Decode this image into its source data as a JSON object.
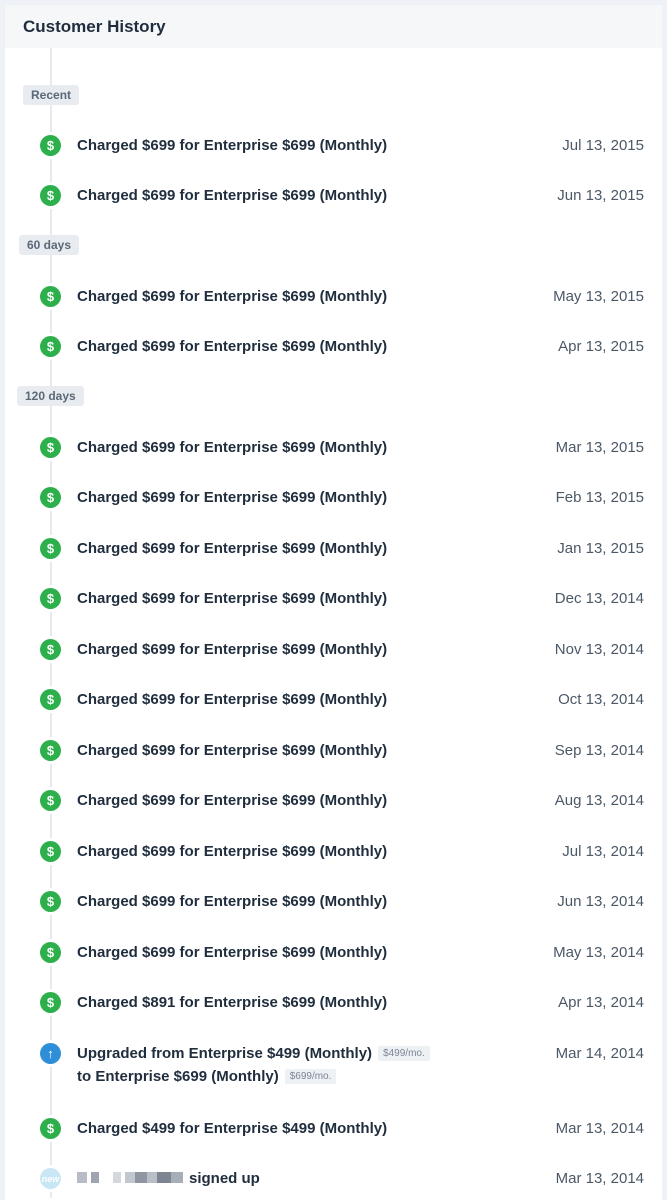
{
  "panel": {
    "title": "Customer History"
  },
  "groups": [
    {
      "label": "Recent"
    },
    {
      "label": "60 days"
    },
    {
      "label": "120 days"
    }
  ],
  "events": [
    {
      "type": "charge",
      "icon": "dollar-icon",
      "text": "Charged $699 for Enterprise $699 (Monthly)",
      "date": "Jul 13, 2015"
    },
    {
      "type": "charge",
      "icon": "dollar-icon",
      "text": "Charged $699 for Enterprise $699 (Monthly)",
      "date": "Jun 13, 2015"
    },
    {
      "type": "charge",
      "icon": "dollar-icon",
      "text": "Charged $699 for Enterprise $699 (Monthly)",
      "date": "May 13, 2015"
    },
    {
      "type": "charge",
      "icon": "dollar-icon",
      "text": "Charged $699 for Enterprise $699 (Monthly)",
      "date": "Apr 13, 2015"
    },
    {
      "type": "charge",
      "icon": "dollar-icon",
      "text": "Charged $699 for Enterprise $699 (Monthly)",
      "date": "Mar 13, 2015"
    },
    {
      "type": "charge",
      "icon": "dollar-icon",
      "text": "Charged $699 for Enterprise $699 (Monthly)",
      "date": "Feb 13, 2015"
    },
    {
      "type": "charge",
      "icon": "dollar-icon",
      "text": "Charged $699 for Enterprise $699 (Monthly)",
      "date": "Jan 13, 2015"
    },
    {
      "type": "charge",
      "icon": "dollar-icon",
      "text": "Charged $699 for Enterprise $699 (Monthly)",
      "date": "Dec 13, 2014"
    },
    {
      "type": "charge",
      "icon": "dollar-icon",
      "text": "Charged $699 for Enterprise $699 (Monthly)",
      "date": "Nov 13, 2014"
    },
    {
      "type": "charge",
      "icon": "dollar-icon",
      "text": "Charged $699 for Enterprise $699 (Monthly)",
      "date": "Oct 13, 2014"
    },
    {
      "type": "charge",
      "icon": "dollar-icon",
      "text": "Charged $699 for Enterprise $699 (Monthly)",
      "date": "Sep 13, 2014"
    },
    {
      "type": "charge",
      "icon": "dollar-icon",
      "text": "Charged $699 for Enterprise $699 (Monthly)",
      "date": "Aug 13, 2014"
    },
    {
      "type": "charge",
      "icon": "dollar-icon",
      "text": "Charged $699 for Enterprise $699 (Monthly)",
      "date": "Jul 13, 2014"
    },
    {
      "type": "charge",
      "icon": "dollar-icon",
      "text": "Charged $699 for Enterprise $699 (Monthly)",
      "date": "Jun 13, 2014"
    },
    {
      "type": "charge",
      "icon": "dollar-icon",
      "text": "Charged $699 for Enterprise $699 (Monthly)",
      "date": "May 13, 2014"
    },
    {
      "type": "charge",
      "icon": "dollar-icon",
      "text": "Charged $891 for Enterprise $699 (Monthly)",
      "date": "Apr 13, 2014"
    }
  ],
  "upgrade": {
    "icon": "arrow-up-icon",
    "line1": "Upgraded from Enterprise $499 (Monthly)",
    "tag1": "$499/mo.",
    "line2": "to Enterprise $699 (Monthly)",
    "tag2": "$699/mo.",
    "date": "Mar 14, 2014"
  },
  "charge_last": {
    "icon": "dollar-icon",
    "text": "Charged $499 for Enterprise $499 (Monthly)",
    "date": "Mar 13, 2014"
  },
  "signup": {
    "icon_label": "new",
    "text": "signed up",
    "date": "Mar 13, 2014"
  },
  "colors": {
    "charge": "#2db04b",
    "upgrade": "#2e8fd8",
    "new": "#c9e6f5"
  }
}
